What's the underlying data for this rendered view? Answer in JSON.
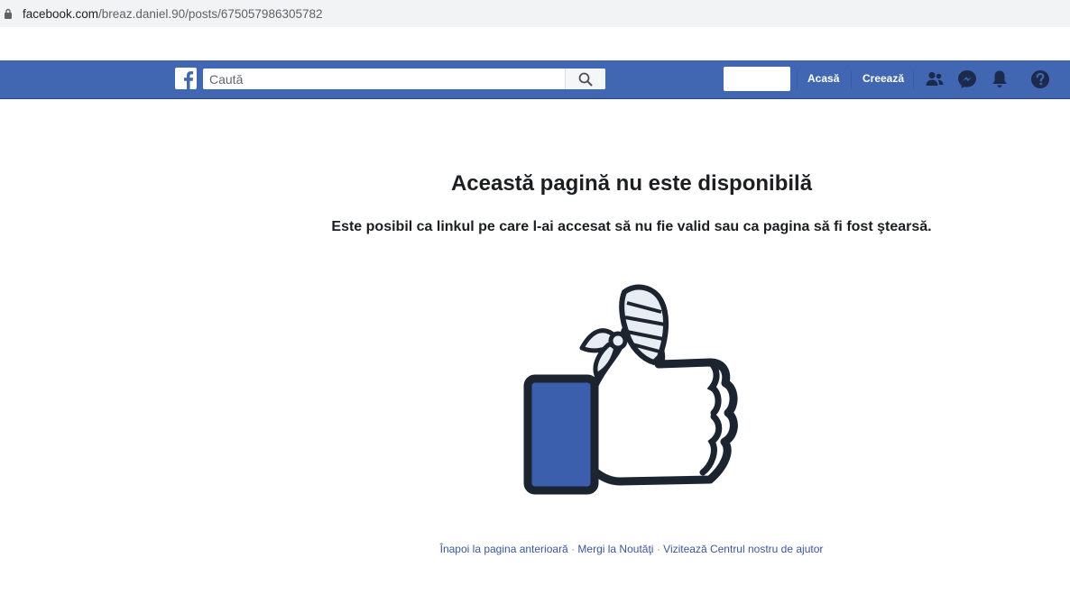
{
  "browser": {
    "url_host": "facebook.com",
    "url_path": "/breaz.daniel.90/posts/675057986305782"
  },
  "header": {
    "search_placeholder": "Caută",
    "nav": {
      "home_label": "Acasă",
      "create_label": "Creează"
    },
    "icons": [
      "facebook-logo-icon",
      "search-icon",
      "friends-icon",
      "messenger-icon",
      "notifications-icon",
      "help-icon"
    ],
    "colors": {
      "bar": "#4267b2",
      "bar_border": "#29487d"
    }
  },
  "main": {
    "title": "Această pagină nu este disponibilă",
    "message": "Este posibil ca linkul pe care l-ai accesat să nu fie valid sau ca pagina să fi fost ştearsă.",
    "illustration": "broken-thumbs-up-icon"
  },
  "footer": {
    "back_link": "Înapoi la pagina anterioară",
    "separator": "·",
    "news_link": "Mergi la Noutăţi",
    "help_link": "Vizitează Centrul nostru de ajutor"
  }
}
